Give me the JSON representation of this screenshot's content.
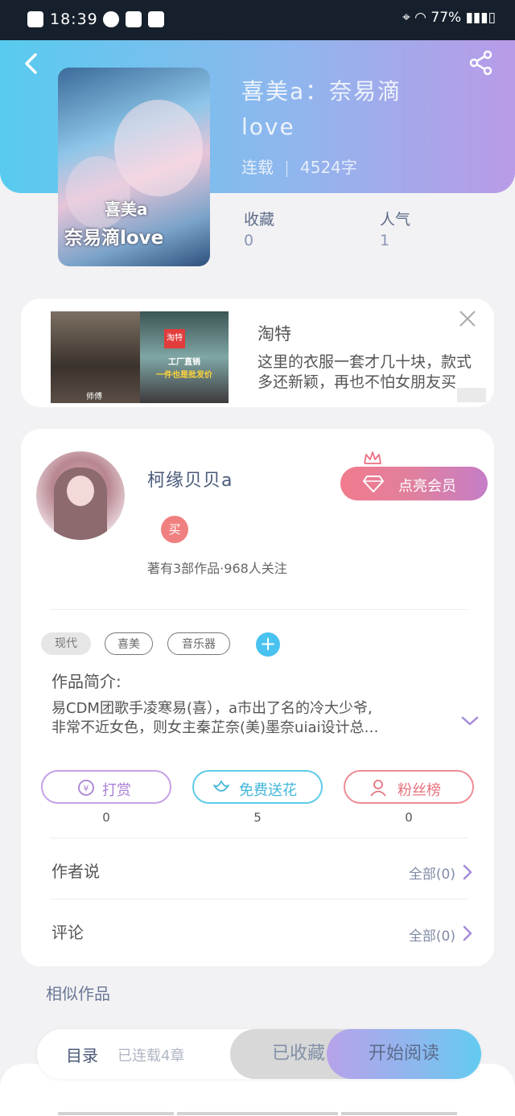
{
  "status_bar": {
    "time": "18:39",
    "battery": "77%"
  },
  "colors": {
    "hero_start": "#58cbef",
    "hero_end": "#b99be8",
    "vip_start": "#f17b8d",
    "vip_end": "#c57ec8",
    "reward": "#a981d4",
    "flower": "#43b6da",
    "fans": "#e6737d",
    "add_tag": "#49c2f0"
  },
  "icons": {
    "back": "back-arrow-icon",
    "share": "share-icon",
    "close": "close-icon",
    "diamond": "diamond-icon",
    "crown": "crown-icon",
    "reward": "yen-coin-icon",
    "flower": "flower-icon",
    "fans": "user-icon",
    "expand": "chevron-down-icon",
    "chevron": "chevron-right-icon"
  },
  "book": {
    "title": "喜美a：奈易滴love",
    "status": "连载",
    "words": "4524字",
    "cover_line1": "喜美a",
    "cover_line2": "奈易滴love",
    "stats": [
      {
        "label": "收藏",
        "value": "0"
      },
      {
        "label": "人气",
        "value": "1"
      }
    ]
  },
  "ad": {
    "title": "淘特",
    "desc_line1": "这里的衣服一套才几十块，款式",
    "desc_line2": "多还新颖，再也不怕女朋友买",
    "img1_caption": "师傅",
    "img2_badge": "淘特",
    "img2_line1": "工厂直销",
    "img2_line2": "一件也是批发价"
  },
  "author": {
    "name": "柯缘贝贝a",
    "vip_label": "点亮会员",
    "level_badge": "买",
    "works_line": "著有3部作品·968人关注",
    "tags": [
      "现代",
      "喜美",
      "音乐器"
    ],
    "add_tag": "+",
    "intro_title": "作品简介:",
    "intro_line1": "易CDM团歌手凌寒易(喜），a市出了名的冷大少爷,",
    "intro_line2": "非常不近女色，则女主秦芷奈(美)墨奈uiai设计总…",
    "actions": [
      {
        "label": "打赏",
        "count": "0"
      },
      {
        "label": "免费送花",
        "count": "5"
      },
      {
        "label": "粉丝榜",
        "count": "0"
      }
    ],
    "rows": [
      {
        "label": "作者说",
        "right": "全部(0)"
      },
      {
        "label": "评论",
        "right": "全部(0)"
      }
    ]
  },
  "similar_title": "相似作品",
  "bottom_bar": {
    "toc_label": "目录",
    "toc_sub": "已连载4章",
    "fav_label": "已收藏",
    "read_label": "开始阅读"
  }
}
